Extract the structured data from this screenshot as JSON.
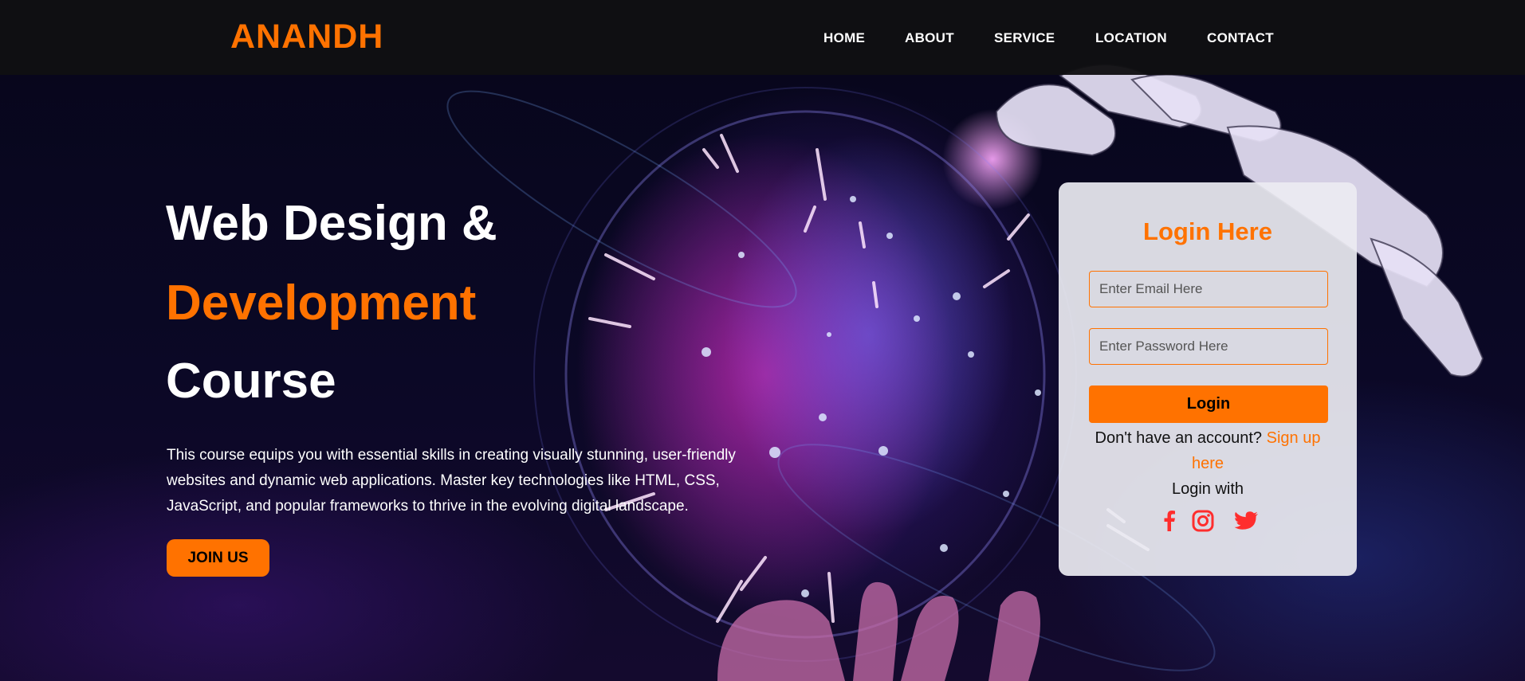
{
  "brand": {
    "logo_text": "ANANDH"
  },
  "nav": {
    "items": [
      {
        "label": "HOME"
      },
      {
        "label": "ABOUT"
      },
      {
        "label": "SERVICE"
      },
      {
        "label": "LOCATION"
      },
      {
        "label": "CONTACT"
      }
    ]
  },
  "hero": {
    "title_line1": "Web Design &",
    "title_line2": "Development",
    "title_line3": "Course",
    "description": "This course equips you with essential skills in creating visually stunning, user-friendly websites and dynamic web applications. Master key technologies like HTML, CSS, JavaScript, and popular frameworks to thrive in the evolving digital landscape.",
    "join_label": "JOIN US"
  },
  "login": {
    "title": "Login Here",
    "email_placeholder": "Enter Email Here",
    "password_placeholder": "Enter Password Here",
    "button_label": "Login",
    "no_account_text": "Don't have an account?",
    "signup_link_text": "Sign up here",
    "login_with_text": "Login with",
    "social": [
      {
        "icon": "facebook-icon"
      },
      {
        "icon": "instagram-icon"
      },
      {
        "icon": "twitter-icon"
      }
    ]
  },
  "colors": {
    "accent": "#ff7200",
    "nav_bg": "#101012",
    "card_bg": "#ececf2",
    "social_icon": "#ff2d2d"
  }
}
